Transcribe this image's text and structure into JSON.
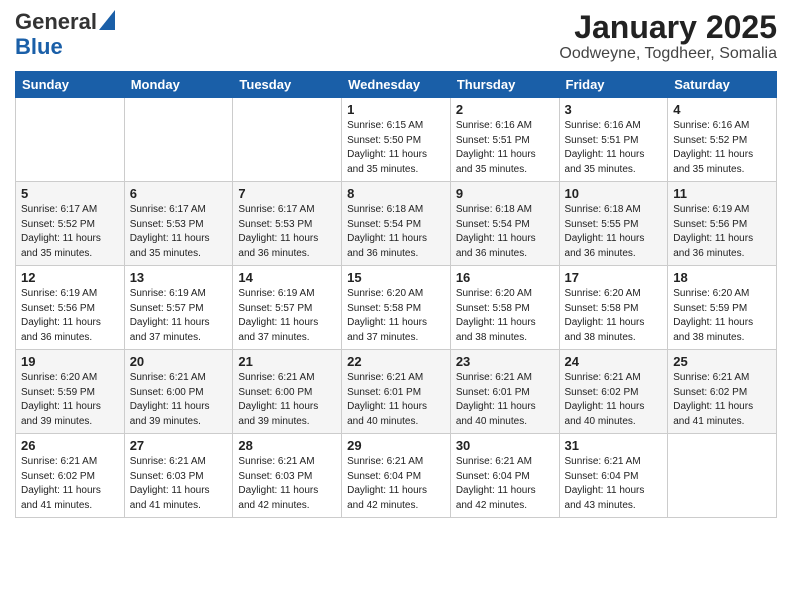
{
  "logo": {
    "general": "General",
    "blue": "Blue"
  },
  "header": {
    "month": "January 2025",
    "location": "Oodweyne, Togdheer, Somalia"
  },
  "weekdays": [
    "Sunday",
    "Monday",
    "Tuesday",
    "Wednesday",
    "Thursday",
    "Friday",
    "Saturday"
  ],
  "weeks": [
    [
      {
        "day": null
      },
      {
        "day": null
      },
      {
        "day": null
      },
      {
        "day": "1",
        "sunrise": "6:15 AM",
        "sunset": "5:50 PM",
        "daylight": "11 hours and 35 minutes."
      },
      {
        "day": "2",
        "sunrise": "6:16 AM",
        "sunset": "5:51 PM",
        "daylight": "11 hours and 35 minutes."
      },
      {
        "day": "3",
        "sunrise": "6:16 AM",
        "sunset": "5:51 PM",
        "daylight": "11 hours and 35 minutes."
      },
      {
        "day": "4",
        "sunrise": "6:16 AM",
        "sunset": "5:52 PM",
        "daylight": "11 hours and 35 minutes."
      }
    ],
    [
      {
        "day": "5",
        "sunrise": "6:17 AM",
        "sunset": "5:52 PM",
        "daylight": "11 hours and 35 minutes."
      },
      {
        "day": "6",
        "sunrise": "6:17 AM",
        "sunset": "5:53 PM",
        "daylight": "11 hours and 35 minutes."
      },
      {
        "day": "7",
        "sunrise": "6:17 AM",
        "sunset": "5:53 PM",
        "daylight": "11 hours and 36 minutes."
      },
      {
        "day": "8",
        "sunrise": "6:18 AM",
        "sunset": "5:54 PM",
        "daylight": "11 hours and 36 minutes."
      },
      {
        "day": "9",
        "sunrise": "6:18 AM",
        "sunset": "5:54 PM",
        "daylight": "11 hours and 36 minutes."
      },
      {
        "day": "10",
        "sunrise": "6:18 AM",
        "sunset": "5:55 PM",
        "daylight": "11 hours and 36 minutes."
      },
      {
        "day": "11",
        "sunrise": "6:19 AM",
        "sunset": "5:56 PM",
        "daylight": "11 hours and 36 minutes."
      }
    ],
    [
      {
        "day": "12",
        "sunrise": "6:19 AM",
        "sunset": "5:56 PM",
        "daylight": "11 hours and 36 minutes."
      },
      {
        "day": "13",
        "sunrise": "6:19 AM",
        "sunset": "5:57 PM",
        "daylight": "11 hours and 37 minutes."
      },
      {
        "day": "14",
        "sunrise": "6:19 AM",
        "sunset": "5:57 PM",
        "daylight": "11 hours and 37 minutes."
      },
      {
        "day": "15",
        "sunrise": "6:20 AM",
        "sunset": "5:58 PM",
        "daylight": "11 hours and 37 minutes."
      },
      {
        "day": "16",
        "sunrise": "6:20 AM",
        "sunset": "5:58 PM",
        "daylight": "11 hours and 38 minutes."
      },
      {
        "day": "17",
        "sunrise": "6:20 AM",
        "sunset": "5:58 PM",
        "daylight": "11 hours and 38 minutes."
      },
      {
        "day": "18",
        "sunrise": "6:20 AM",
        "sunset": "5:59 PM",
        "daylight": "11 hours and 38 minutes."
      }
    ],
    [
      {
        "day": "19",
        "sunrise": "6:20 AM",
        "sunset": "5:59 PM",
        "daylight": "11 hours and 39 minutes."
      },
      {
        "day": "20",
        "sunrise": "6:21 AM",
        "sunset": "6:00 PM",
        "daylight": "11 hours and 39 minutes."
      },
      {
        "day": "21",
        "sunrise": "6:21 AM",
        "sunset": "6:00 PM",
        "daylight": "11 hours and 39 minutes."
      },
      {
        "day": "22",
        "sunrise": "6:21 AM",
        "sunset": "6:01 PM",
        "daylight": "11 hours and 40 minutes."
      },
      {
        "day": "23",
        "sunrise": "6:21 AM",
        "sunset": "6:01 PM",
        "daylight": "11 hours and 40 minutes."
      },
      {
        "day": "24",
        "sunrise": "6:21 AM",
        "sunset": "6:02 PM",
        "daylight": "11 hours and 40 minutes."
      },
      {
        "day": "25",
        "sunrise": "6:21 AM",
        "sunset": "6:02 PM",
        "daylight": "11 hours and 41 minutes."
      }
    ],
    [
      {
        "day": "26",
        "sunrise": "6:21 AM",
        "sunset": "6:02 PM",
        "daylight": "11 hours and 41 minutes."
      },
      {
        "day": "27",
        "sunrise": "6:21 AM",
        "sunset": "6:03 PM",
        "daylight": "11 hours and 41 minutes."
      },
      {
        "day": "28",
        "sunrise": "6:21 AM",
        "sunset": "6:03 PM",
        "daylight": "11 hours and 42 minutes."
      },
      {
        "day": "29",
        "sunrise": "6:21 AM",
        "sunset": "6:04 PM",
        "daylight": "11 hours and 42 minutes."
      },
      {
        "day": "30",
        "sunrise": "6:21 AM",
        "sunset": "6:04 PM",
        "daylight": "11 hours and 42 minutes."
      },
      {
        "day": "31",
        "sunrise": "6:21 AM",
        "sunset": "6:04 PM",
        "daylight": "11 hours and 43 minutes."
      },
      {
        "day": null
      }
    ]
  ]
}
